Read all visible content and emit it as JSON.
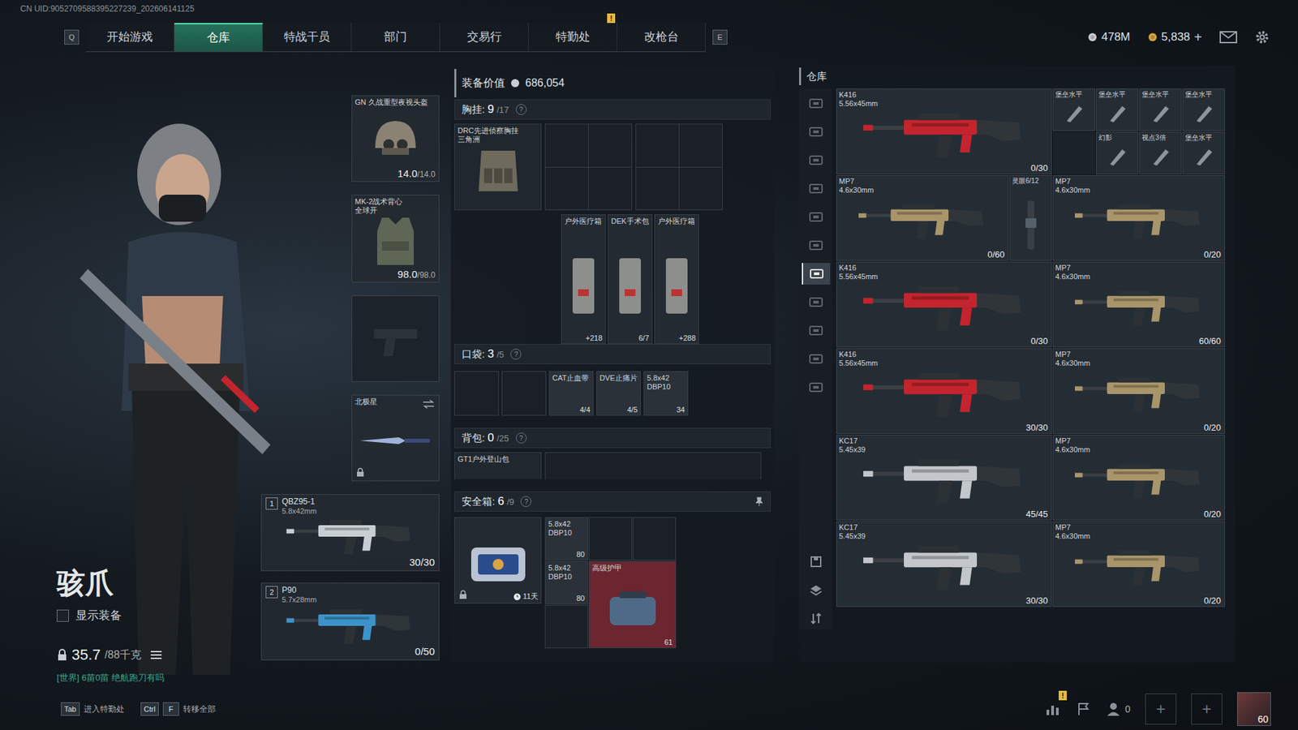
{
  "uid": "CN UID:9052709588395227239_202606141125",
  "nav": {
    "prev_key": "Q",
    "next_key": "E",
    "tabs": [
      {
        "label": "开始游戏",
        "selected": false,
        "alert": ""
      },
      {
        "label": "仓库",
        "selected": true,
        "alert": ""
      },
      {
        "label": "特战干员",
        "selected": false,
        "alert": ""
      },
      {
        "label": "部门",
        "selected": false,
        "alert": ""
      },
      {
        "label": "交易行",
        "selected": false,
        "alert": ""
      },
      {
        "label": "特勤处",
        "selected": false,
        "alert": "!"
      },
      {
        "label": "改枪台",
        "selected": false,
        "alert": ""
      }
    ]
  },
  "wallet": [
    {
      "amount": "478M",
      "add": "",
      "color": "#c9ced4"
    },
    {
      "amount": "5,838",
      "add": "+",
      "color": "#d9a441"
    }
  ],
  "character": {
    "name": "骇爪",
    "show_equipment": {
      "label": "显示装备",
      "checked": false
    },
    "weight": "35.7",
    "weight_max": "/88千克",
    "chat": "[世界] 6苗0苗 绝航跑刀有吗"
  },
  "equipment": {
    "helmet": {
      "name": "GN 久战重型夜视头盔",
      "durability": "14.0",
      "max": "/14.0"
    },
    "armor": {
      "name": "MK-2战术背心",
      "sub": "全球开",
      "durability": "98.0",
      "max": "/98.0"
    },
    "pistol": {
      "kind": "empty"
    },
    "melee": {
      "name": "北极星",
      "locked": true
    },
    "weapons": [
      {
        "slot": "1",
        "name": "QBZ95-1",
        "caliber": "5.8x42mm",
        "ammo": "30/30",
        "color": "#c9ced3"
      },
      {
        "slot": "2",
        "name": "P90",
        "caliber": "5.7x28mm",
        "ammo": "0/50",
        "color": "#3d93c9"
      }
    ]
  },
  "loadout": {
    "value_label": "装备价值",
    "value": "686,054",
    "chest": {
      "title": "胸挂:",
      "used": "9",
      "cap": "/17",
      "help": "?",
      "top": [
        {
          "kind": "rig",
          "name": "DRC先进侦察胸挂",
          "sub": "三角洲"
        },
        {
          "kind": "empty"
        },
        {
          "kind": "empty"
        }
      ],
      "items": [
        {
          "name": "户外医疗箱",
          "count": "+218"
        },
        {
          "name": "DEK手术包",
          "count": "6/7"
        },
        {
          "name": "户外医疗箱",
          "count": "+288"
        }
      ]
    },
    "pockets": {
      "title": "口袋:",
      "used": "3",
      "cap": "/5",
      "help": "?",
      "items": [
        {
          "kind": "empty"
        },
        {
          "kind": "empty"
        },
        {
          "kind": "tourniquet",
          "name": "CAT止血带",
          "sub": "",
          "count": "4/4"
        },
        {
          "kind": "pills",
          "name": "DVE止痛片",
          "sub": "",
          "count": "4/5"
        },
        {
          "kind": "ammo",
          "name": "5.8x42",
          "sub": "DBP10",
          "count": "34"
        }
      ]
    },
    "backpack": {
      "title": "背包:",
      "used": "0",
      "cap": "/25",
      "help": "?",
      "bag": "GT1户外登山包"
    },
    "safe": {
      "title": "安全箱:",
      "used": "6",
      "cap": "/9",
      "help": "?",
      "timer": "11天",
      "items": [
        {
          "kind": "ammo",
          "name": "5.8x42",
          "sub": "DBP10",
          "count": "80"
        },
        {
          "kind": "empty"
        },
        {
          "kind": "empty"
        },
        {
          "kind": "ammo",
          "name": "5.8x42",
          "sub": "DBP10",
          "count": "80"
        },
        {
          "kind": "armor",
          "name": "高级护甲",
          "sub": "",
          "count": "61"
        },
        {
          "kind": "empty"
        }
      ]
    }
  },
  "warehouse": {
    "title": "仓库",
    "tabs": [
      {
        "selected": false
      },
      {
        "selected": false
      },
      {
        "selected": false
      },
      {
        "selected": false
      },
      {
        "selected": false
      },
      {
        "selected": false
      },
      {
        "selected": true
      },
      {
        "selected": false
      },
      {
        "selected": false
      },
      {
        "selected": false
      },
      {
        "selected": false
      }
    ],
    "items": [
      {
        "kind": "rifle",
        "name": "K416",
        "caliber": "5.56x45mm",
        "ammo": "0/30",
        "color": "#c4242d"
      },
      {
        "kind": "attachment",
        "name": "堡垒水平"
      },
      {
        "kind": "attachment",
        "name": "堡垒水平"
      },
      {
        "kind": "attachment",
        "name": "堡垒水平"
      },
      {
        "kind": "attachment",
        "name": "堡垒水平"
      },
      {
        "kind": "empty"
      },
      {
        "kind": "attachment",
        "name": "幻影"
      },
      {
        "kind": "attachment",
        "name": "视点3倍"
      },
      {
        "kind": "attachment",
        "name": "堡垒水平"
      },
      {
        "kind": "smg",
        "name": "MP7",
        "caliber": "4.6x30mm",
        "ammo": "0/60",
        "color": "#a8956a"
      },
      {
        "kind": "scope",
        "name": "灵眼6/12"
      },
      {
        "kind": "smg",
        "name": "MP7",
        "caliber": "4.6x30mm",
        "ammo": "0/20",
        "color": "#a8956a"
      },
      {
        "kind": "rifle",
        "name": "K416",
        "caliber": "5.56x45mm",
        "ammo": "0/30",
        "color": "#c4242d"
      },
      {
        "kind": "smg",
        "name": "MP7",
        "caliber": "4.6x30mm",
        "ammo": "60/60",
        "color": "#a8956a"
      },
      {
        "kind": "rifle",
        "name": "K416",
        "caliber": "5.56x45mm",
        "ammo": "30/30",
        "color": "#c4242d"
      },
      {
        "kind": "smg",
        "name": "MP7",
        "caliber": "4.6x30mm",
        "ammo": "0/20",
        "color": "#a8956a"
      },
      {
        "kind": "rifle",
        "name": "KC17",
        "caliber": "5.45x39",
        "ammo": "45/45",
        "color": "#c3c7cc"
      },
      {
        "kind": "smg",
        "name": "MP7",
        "caliber": "4.6x30mm",
        "ammo": "0/20",
        "color": "#a8956a"
      },
      {
        "kind": "rifle",
        "name": "KC17",
        "caliber": "5.45x39",
        "ammo": "30/30",
        "color": "#c3c7cc"
      },
      {
        "kind": "smg",
        "name": "MP7",
        "caliber": "4.6x30mm",
        "ammo": "0/20",
        "color": "#a8956a"
      }
    ],
    "tools": [
      {
        "kind": "save"
      },
      {
        "kind": "layers"
      },
      {
        "kind": "sort"
      }
    ]
  },
  "bottom": {
    "keys": [
      {
        "keys": [
          "Tab"
        ],
        "label": "进入特勤处"
      },
      {
        "keys": [
          "Ctrl",
          "F"
        ],
        "label": "转移全部"
      }
    ],
    "stats_alert": "!",
    "friends": "0",
    "plus": [
      "+",
      "+"
    ],
    "level": "60"
  }
}
